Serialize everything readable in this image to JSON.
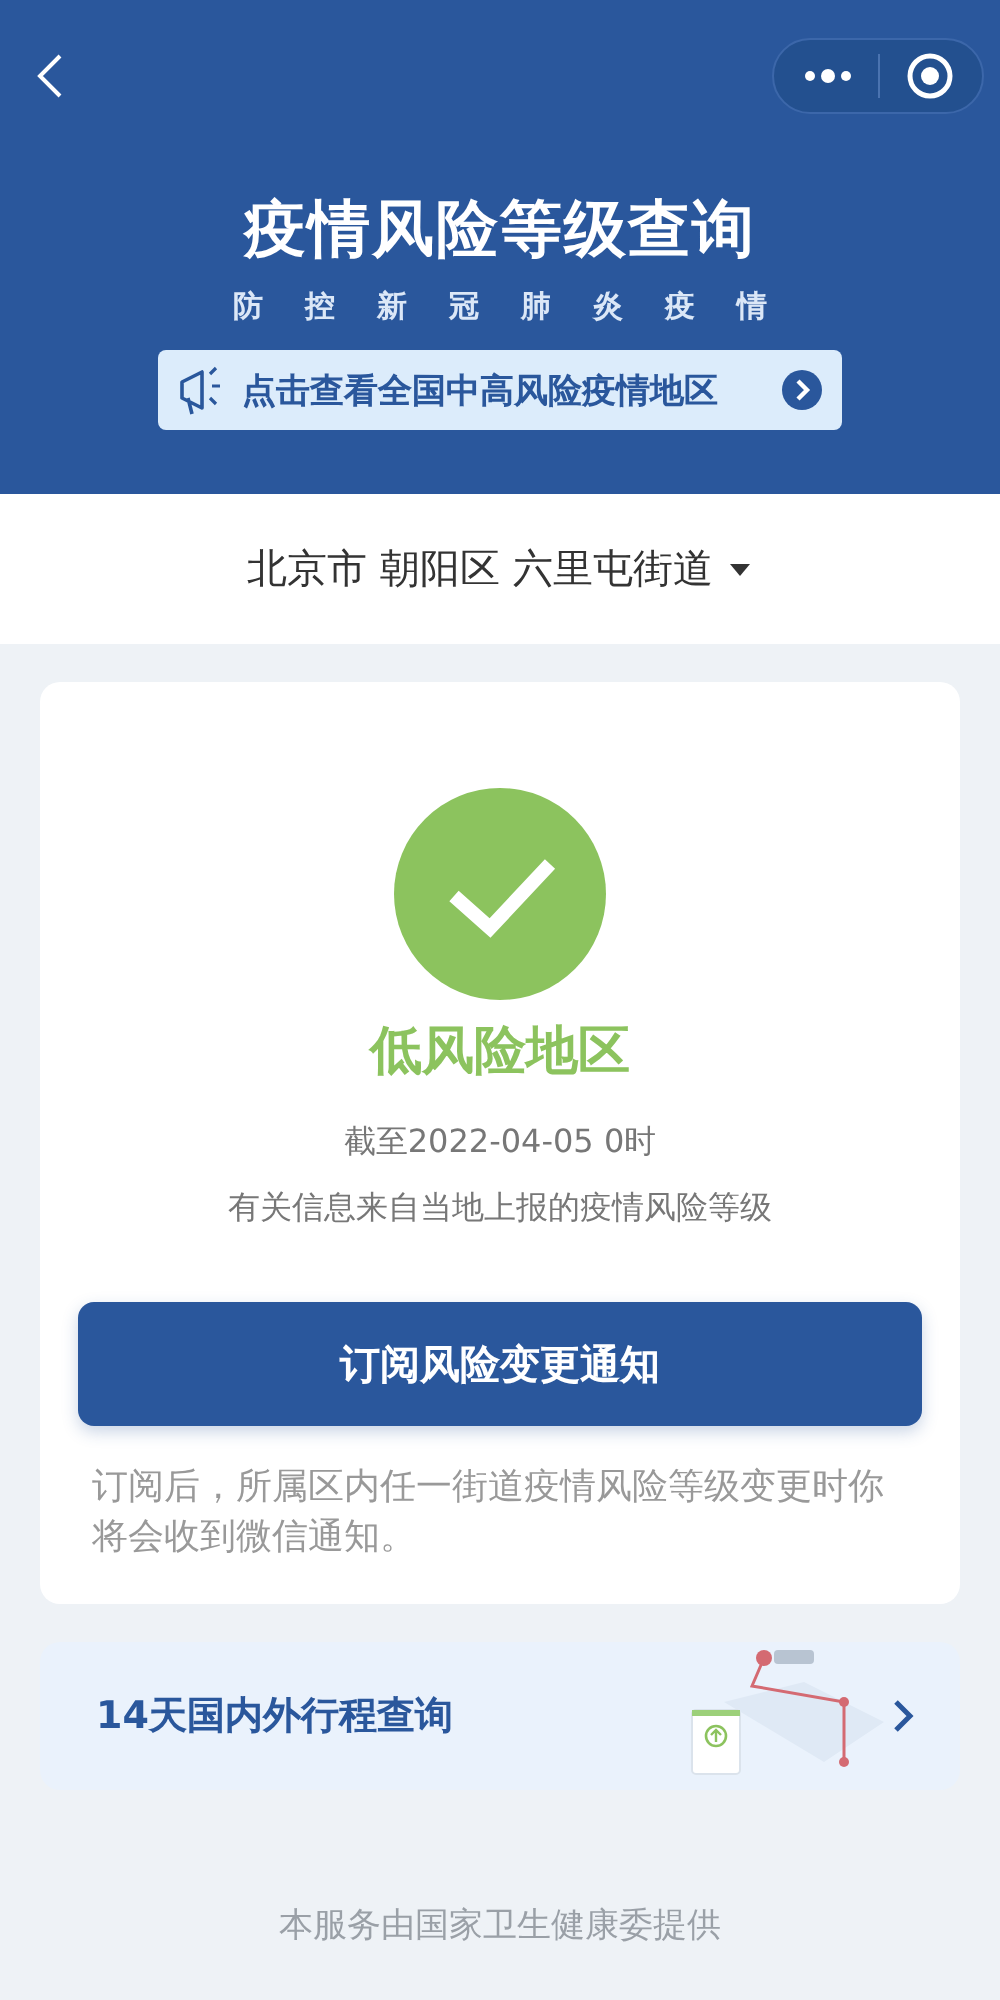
{
  "header": {
    "title": "疫情风险等级查询",
    "subtitle": "防控新冠肺炎疫情",
    "banner": {
      "text": "点击查看全国中高风险疫情地区"
    }
  },
  "location": {
    "text": "北京市 朝阳区 六里屯街道"
  },
  "result": {
    "risk": "低风险地区",
    "as_of": "截至2022-04-05 0时",
    "source": "有关信息来自当地上报的疫情风险等级"
  },
  "subscribe": {
    "button": "订阅风险变更通知",
    "note": "订阅后，所属区内任一街道疫情风险等级变更时你将会收到微信通知。"
  },
  "travel": {
    "text": "14天国内外行程查询"
  },
  "footer": "本服务由国家卫生健康委提供"
}
